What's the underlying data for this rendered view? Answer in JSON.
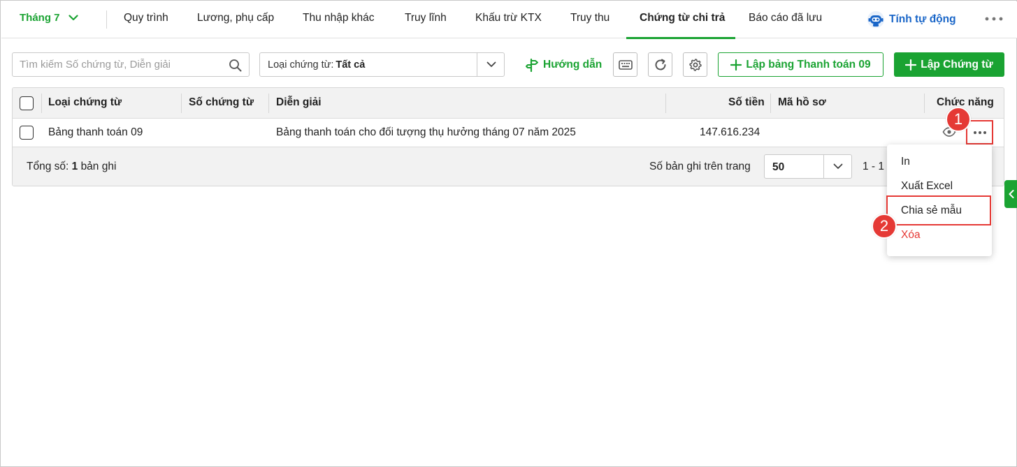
{
  "nav": {
    "month": "Tháng 7",
    "tabs": [
      {
        "label": "Quy trình"
      },
      {
        "label": "Lương, phụ cấp"
      },
      {
        "label": "Thu nhập khác"
      },
      {
        "label": "Truy lĩnh"
      },
      {
        "label": "Khấu trừ KTX"
      },
      {
        "label": "Truy thu"
      },
      {
        "label": "Chứng từ chi trả",
        "active": true
      },
      {
        "label": "Báo cáo đã lưu"
      }
    ],
    "auto_calc": "Tính tự động",
    "more_icon": "more-horizontal-icon"
  },
  "toolbar": {
    "search_placeholder": "Tìm kiếm Số chứng từ, Diễn giải",
    "filter_label": "Loại chứng từ:",
    "filter_value": "Tất cả",
    "guide": "Hướng dẫn",
    "create_payment_table": "Lập bảng Thanh toán 09",
    "create_voucher": "Lập Chứng từ"
  },
  "table": {
    "columns": [
      "Loại chứng từ",
      "Số chứng từ",
      "Diễn giải",
      "Số tiền",
      "Mã hồ sơ",
      "Chức năng"
    ],
    "rows": [
      {
        "type": "Bảng thanh toán 09",
        "number": "",
        "description": "Bảng thanh toán cho đối tượng thụ hưởng tháng 07 năm 2025",
        "amount": "147.616.234",
        "record_code": ""
      }
    ],
    "footer": {
      "total_prefix": "Tổng số:",
      "total_count": "1",
      "total_suffix": "bản ghi",
      "per_page_label": "Số bản ghi trên trang",
      "per_page_value": "50",
      "range": "1 - 1"
    }
  },
  "context_menu": {
    "items": [
      {
        "label": "In"
      },
      {
        "label": "Xuất Excel"
      },
      {
        "label": "Chia sẻ mẫu"
      },
      {
        "label": "Xóa",
        "danger": true
      }
    ]
  },
  "annotations": {
    "step1": "1",
    "step2": "2"
  },
  "colors": {
    "accent": "#1aa332",
    "danger": "#e53935",
    "link": "#1a66c8"
  }
}
